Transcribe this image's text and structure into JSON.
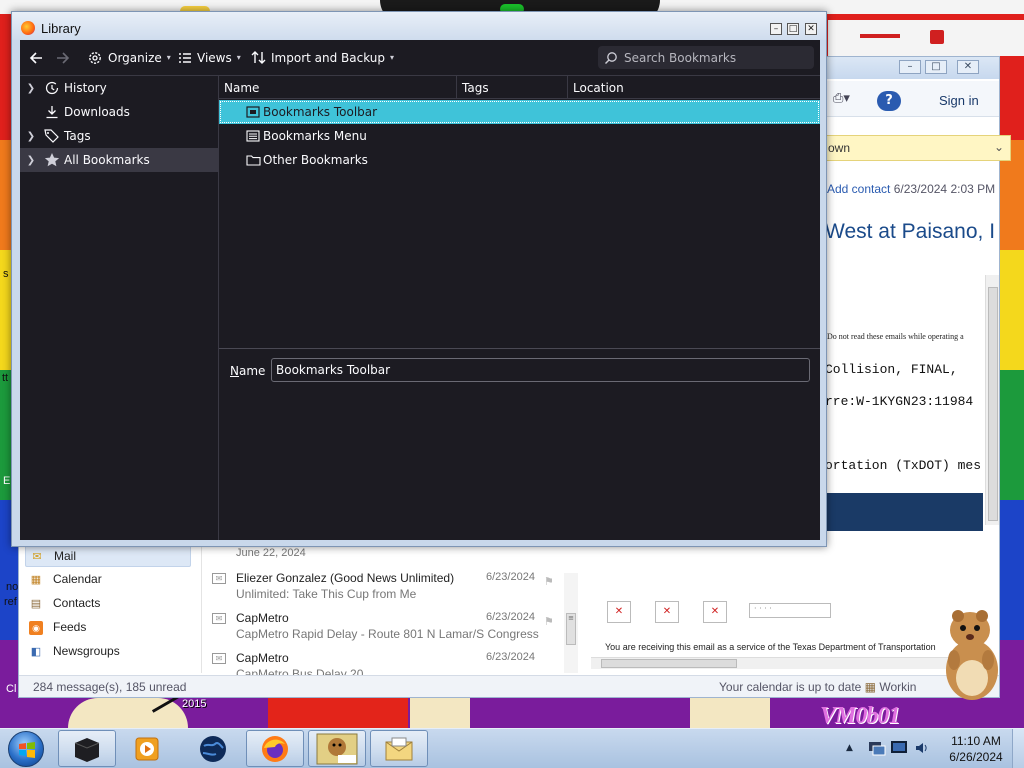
{
  "library": {
    "title": "Library",
    "toolbar": {
      "organize": "Organize",
      "views": "Views",
      "import_backup": "Import and Backup",
      "search_placeholder": "Search Bookmarks"
    },
    "sidebar": [
      {
        "label": "History",
        "icon": "history-icon",
        "expandable": true
      },
      {
        "label": "Downloads",
        "icon": "download-icon",
        "expandable": false
      },
      {
        "label": "Tags",
        "icon": "tag-icon",
        "expandable": true
      },
      {
        "label": "All Bookmarks",
        "icon": "star-icon",
        "expandable": true,
        "selected": true
      }
    ],
    "columns": [
      "Name",
      "Tags",
      "Location"
    ],
    "rows": [
      {
        "name": "Bookmarks Toolbar",
        "icon": "toolbar-icon",
        "selected": true
      },
      {
        "name": "Bookmarks Menu",
        "icon": "menu-icon",
        "selected": false
      },
      {
        "name": "Other Bookmarks",
        "icon": "folder-icon",
        "selected": false
      }
    ],
    "details": {
      "name_label": "Name",
      "name_value": "Bookmarks Toolbar"
    },
    "colors": {
      "dark_bg": "#1c1b22",
      "selection": "#3fc3d9",
      "text": "#fbfbfe"
    }
  },
  "mail": {
    "signin": "Sign in",
    "show_download": "own",
    "add_contact": "Add contact",
    "received": "6/23/2024 2:03 PM",
    "subject_fragment": "West at Paisano, I",
    "body_notice": "Do not read these emails while operating a",
    "body_lines": [
      "Collision, FINAL,",
      "rre:W-1KYGN23:11984",
      "ortation (TxDOT) mes"
    ],
    "footer_text": "You are receiving this email as a service of the Texas Department of Transportation",
    "folders": [
      "Mail",
      "Calendar",
      "Contacts",
      "Feeds",
      "Newsgroups"
    ],
    "list_date_header": "June 22, 2024",
    "messages": [
      {
        "from": "Eliezer Gonzalez (Good News Unlimited)",
        "subject": "Unlimited: Take This Cup from Me",
        "date": "6/23/2024"
      },
      {
        "from": "CapMetro",
        "subject": "CapMetro Rapid Delay - Route 801 N Lamar/S Congress",
        "date": "6/23/2024"
      },
      {
        "from": "CapMetro",
        "subject": "CapMetro Bus Delay 20",
        "date": "6/23/2024"
      }
    ],
    "status_left": "284 message(s), 185 unread",
    "status_right": "Your calendar is up to date",
    "status_work": "Workin"
  },
  "desktop": {
    "watermark": "VM0b01",
    "year": "2015",
    "left_fragments": [
      "no",
      "ref",
      "Cl",
      "E",
      "tt",
      "s"
    ]
  },
  "taskbar": {
    "time": "11:10 AM",
    "date": "6/26/2024",
    "buttons": [
      "app-icon",
      "media-player-icon",
      "globe-icon",
      "firefox-icon",
      "gopher-icon",
      "mail-icon"
    ]
  }
}
